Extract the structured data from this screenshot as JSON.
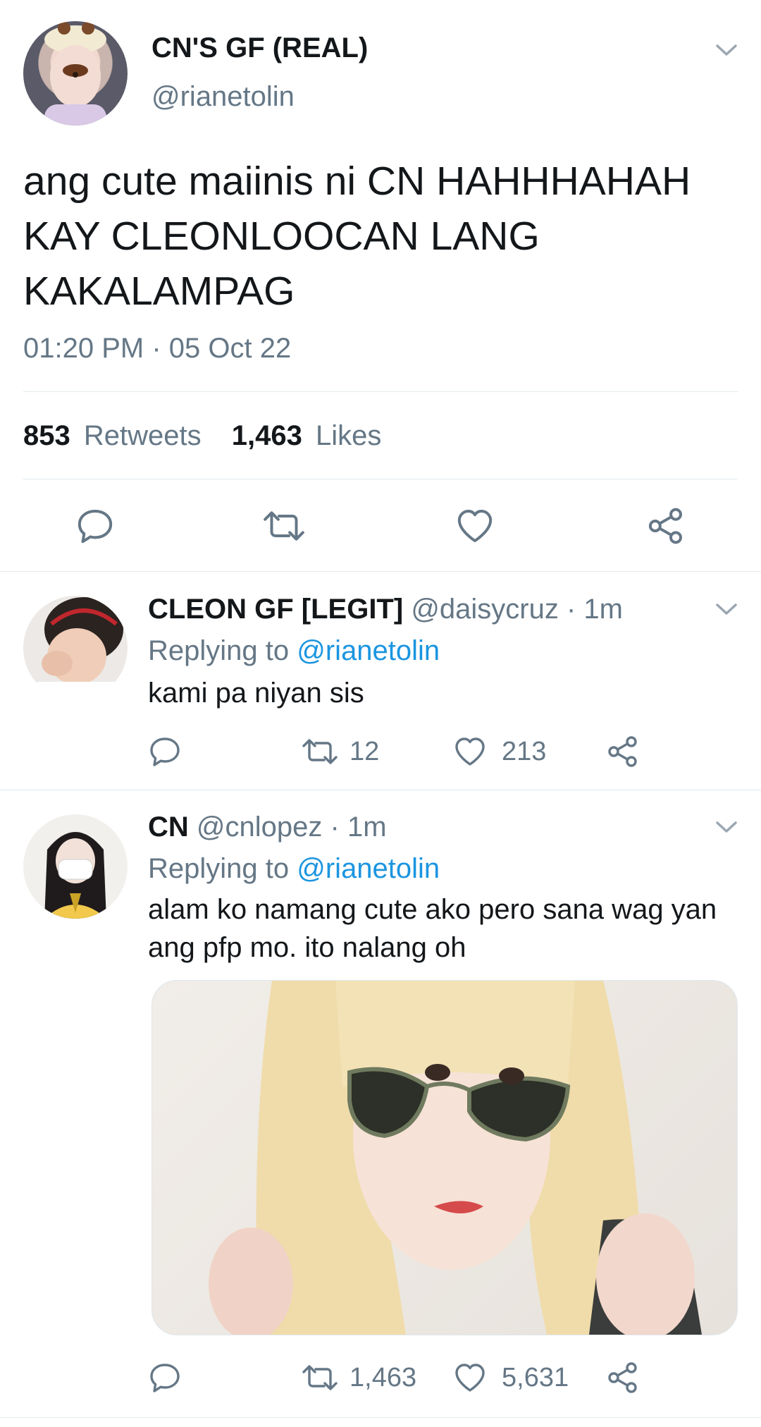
{
  "main_tweet": {
    "display_name": "CN'S GF (REAL)",
    "handle": "@rianetolin",
    "text_lines": [
      "ang cute maiinis ni CN HAHHHAHAH",
      "KAY CLEONLOOCAN LANG",
      "KAKALAMPAG"
    ],
    "timestamp": "01:20 PM · 05 Oct 22",
    "retweets_count": "853",
    "retweets_label": "Retweets",
    "likes_count": "1,463",
    "likes_label": "Likes"
  },
  "replies": [
    {
      "display_name": "CLEON GF [LEGIT]",
      "handle": "@daisycruz",
      "time": "· 1m",
      "replying_label": "Replying to",
      "replying_handle": "@rianetolin",
      "text_lines": [
        "kami pa niyan sis"
      ],
      "retweets": "12",
      "likes": "213"
    },
    {
      "display_name": "CN",
      "handle": "@cnlopez",
      "time": "· 1m",
      "replying_label": "Replying to",
      "replying_handle": "@rianetolin",
      "text_lines": [
        "alam ko namang cute ako pero sana wag yan",
        "ang pfp mo. ito nalang oh"
      ],
      "retweets": "1,463",
      "likes": "5,631"
    }
  ],
  "icons": {
    "reply": "reply-bubble-icon",
    "retweet": "retweet-arrows-icon",
    "like": "heart-icon",
    "share": "share-nodes-icon",
    "menu": "chevron-down-icon"
  },
  "colors": {
    "text": "#14171a",
    "secondary": "#657786",
    "link": "#1b95e0",
    "divider": "#e1e8ed"
  }
}
